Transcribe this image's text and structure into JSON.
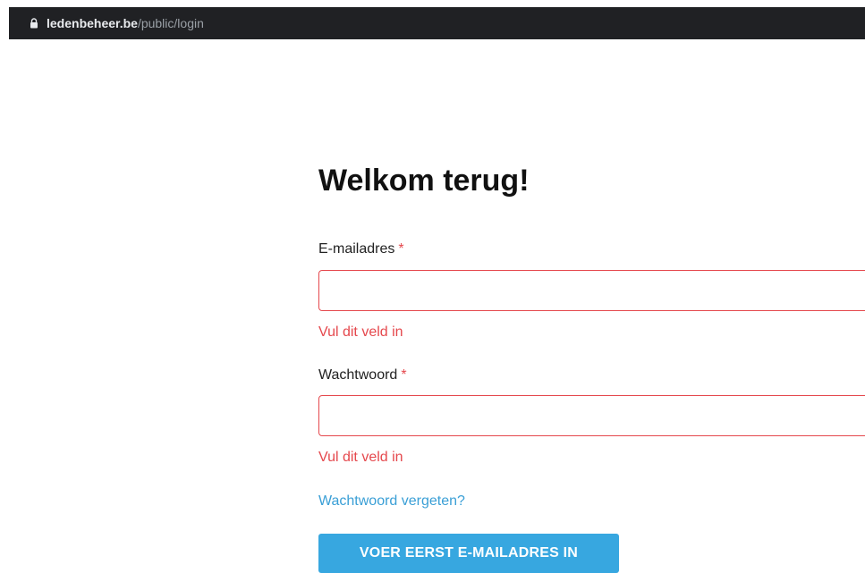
{
  "browser": {
    "url_host": "ledenbeheer.be",
    "url_path": "/public/login"
  },
  "login": {
    "title": "Welkom terug!",
    "email": {
      "label": "E-mailadres",
      "required_marker": "*",
      "value": "",
      "error": "Vul dit veld in"
    },
    "password": {
      "label": "Wachtwoord",
      "required_marker": "*",
      "value": "",
      "error": "Vul dit veld in"
    },
    "forgot_link": "Wachtwoord vergeten?",
    "submit_label": "VOER EERST E-MAILADRES IN"
  },
  "colors": {
    "error": "#e5484d",
    "link": "#3a9fd6",
    "button": "#37a7e0",
    "address_bar": "#202124"
  },
  "icons": {
    "address_bar": "lock-icon"
  }
}
